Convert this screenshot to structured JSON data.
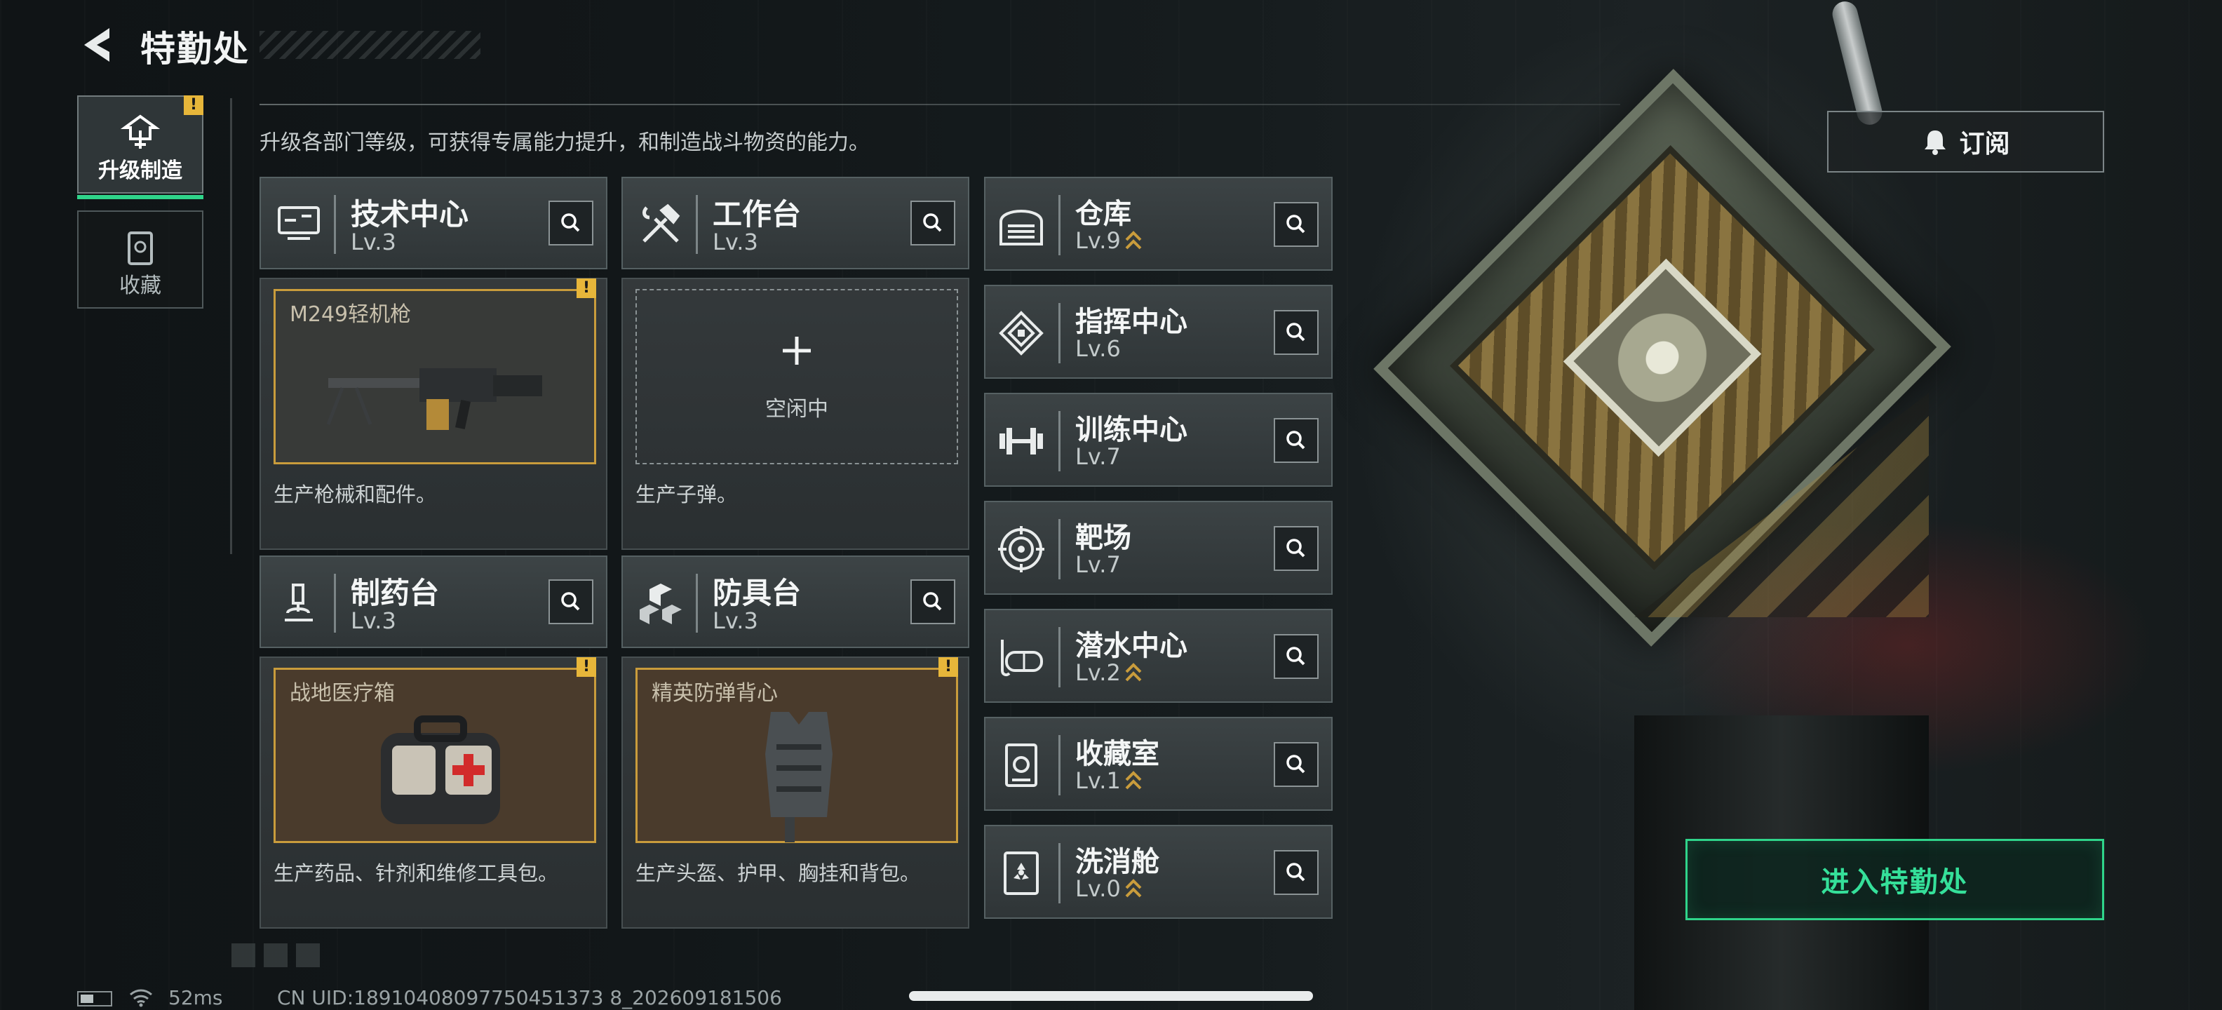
{
  "header": {
    "title": "特勤处"
  },
  "side_tabs": [
    {
      "label": "升级制造",
      "active": true,
      "alert": "!"
    },
    {
      "label": "收藏",
      "active": false
    }
  ],
  "description": "升级各部门等级，可获得专属能力提升，和制造战斗物资的能力。",
  "subscribe": {
    "label": "订阅"
  },
  "facilities_large": [
    {
      "name": "技术中心",
      "level": "Lv.3",
      "slot_item": "M249轻机枪",
      "slot_alert": "!",
      "desc": "生产枪械和配件。",
      "icon": "monitor-icon"
    },
    {
      "name": "工作台",
      "level": "Lv.3",
      "slot_item": "",
      "idle_label": "空闲中",
      "desc": "生产子弹。",
      "icon": "hammer-wrench-icon"
    },
    {
      "name": "制药台",
      "level": "Lv.3",
      "slot_item": "战地医疗箱",
      "slot_alert": "!",
      "desc": "生产药品、针剂和维修工具包。",
      "icon": "microscope-icon"
    },
    {
      "name": "防具台",
      "level": "Lv.3",
      "slot_item": "精英防弹背心",
      "slot_alert": "!",
      "desc": "生产头盔、护甲、胸挂和背包。",
      "icon": "cubes-icon"
    }
  ],
  "facilities_rows": [
    {
      "name": "仓库",
      "level": "Lv.9",
      "upgradable": true,
      "icon": "warehouse-icon"
    },
    {
      "name": "指挥中心",
      "level": "Lv.6",
      "upgradable": false,
      "icon": "command-chip-icon"
    },
    {
      "name": "训练中心",
      "level": "Lv.7",
      "upgradable": false,
      "icon": "dumbbell-icon"
    },
    {
      "name": "靶场",
      "level": "Lv.7",
      "upgradable": false,
      "icon": "target-icon"
    },
    {
      "name": "潜水中心",
      "level": "Lv.2",
      "upgradable": true,
      "icon": "diving-mask-icon"
    },
    {
      "name": "收藏室",
      "level": "Lv.1",
      "upgradable": true,
      "icon": "collection-icon"
    },
    {
      "name": "洗消舱",
      "level": "Lv.0",
      "upgradable": true,
      "icon": "radiation-icon"
    }
  ],
  "enter_button": {
    "label": "进入特勤处"
  },
  "status": {
    "ping": "52ms",
    "uid": "CN UID:18910408097750451373 8_202609181506"
  },
  "colors": {
    "accent_green": "#2fd48a",
    "alert_yellow": "#e7b63a",
    "upgrade_gold": "#c99c3c"
  }
}
